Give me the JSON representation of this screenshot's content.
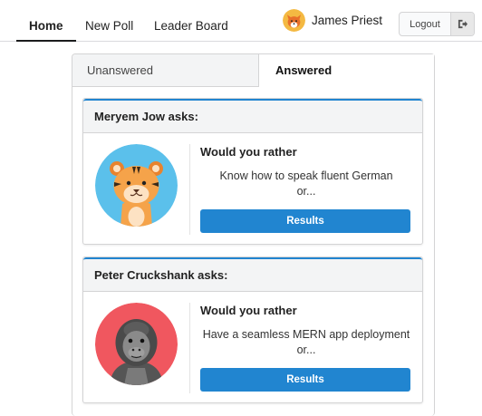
{
  "nav": {
    "items": [
      {
        "label": "Home",
        "active": true
      },
      {
        "label": "New Poll",
        "active": false
      },
      {
        "label": "Leader Board",
        "active": false
      }
    ],
    "user_name": "James Priest",
    "logout_label": "Logout",
    "logout_icon": "sign-out-icon",
    "avatar_icon": "fox-avatar-icon"
  },
  "tabs": {
    "unanswered": "Unanswered",
    "answered": "Answered",
    "active": "Answered"
  },
  "colors": {
    "accent": "#2185d0",
    "card_header_bg": "#f3f4f5",
    "tiger_bg": "#5bc0eb",
    "gorilla_bg": "#f0575f"
  },
  "polls": [
    {
      "author_line": "Meryem Jow asks:",
      "avatar_icon": "tiger-avatar-icon",
      "question": "Would you rather",
      "option_text": "Know how to speak fluent German",
      "or_text": "or...",
      "button_label": "Results"
    },
    {
      "author_line": "Peter Cruckshank asks:",
      "avatar_icon": "gorilla-avatar-icon",
      "question": "Would you rather",
      "option_text": "Have a seamless MERN app deployment",
      "or_text": "or...",
      "button_label": "Results"
    }
  ]
}
